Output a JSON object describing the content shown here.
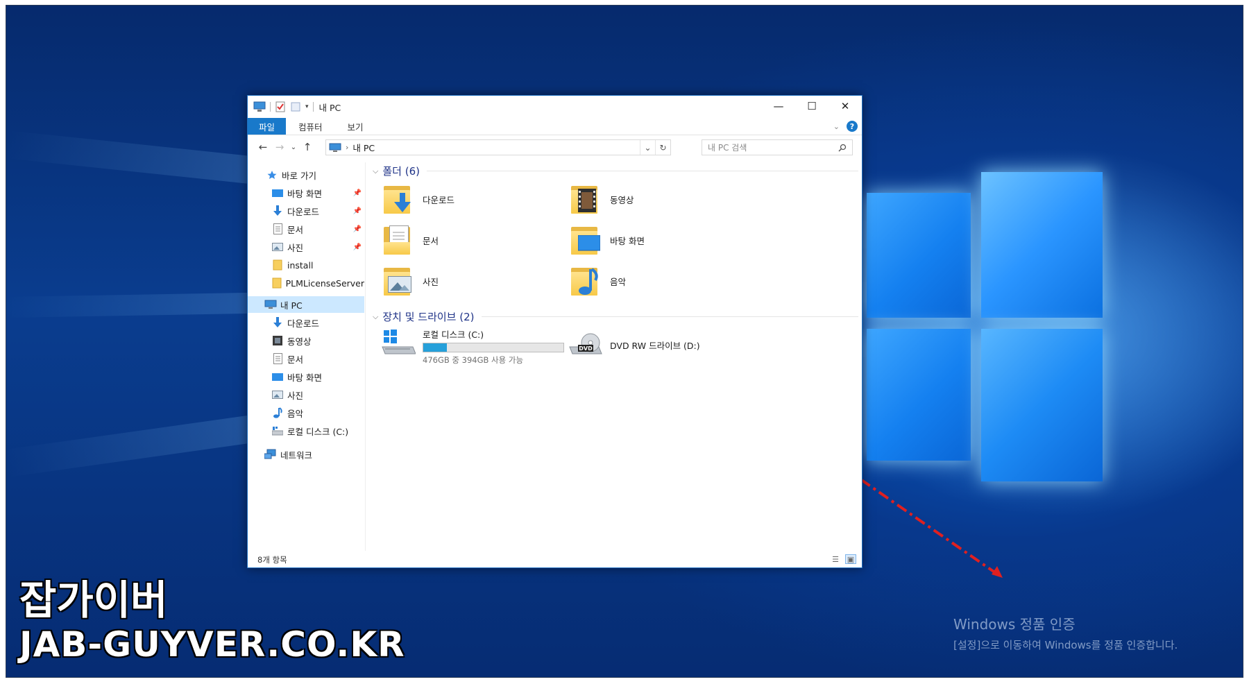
{
  "branding": {
    "site_name_kr": "잡가이버",
    "site_url": "JAB-GUYVER.CO.KR"
  },
  "activation_watermark": {
    "title": "Windows 정품 인증",
    "description": "[설정]으로 이동하여 Windows를 정품 인증합니다."
  },
  "window": {
    "title": "내 PC",
    "ribbon_tabs": [
      "파일",
      "컴퓨터",
      "보기"
    ],
    "address": "내 PC",
    "search_placeholder": "내 PC 검색",
    "status": "8개 항목"
  },
  "sidebar": {
    "quick_access": "바로 가기",
    "quick_items": [
      {
        "label": "바탕 화면",
        "icon": "desktop-icon",
        "pinned": true
      },
      {
        "label": "다운로드",
        "icon": "download-icon",
        "pinned": true
      },
      {
        "label": "문서",
        "icon": "document-icon",
        "pinned": true
      },
      {
        "label": "사진",
        "icon": "picture-icon",
        "pinned": true
      },
      {
        "label": "install",
        "icon": "folder-icon",
        "pinned": false
      },
      {
        "label": "PLMLicenseServer",
        "icon": "folder-icon",
        "pinned": false
      }
    ],
    "this_pc": "내 PC",
    "pc_items": [
      {
        "label": "다운로드",
        "icon": "download-icon"
      },
      {
        "label": "동영상",
        "icon": "video-icon"
      },
      {
        "label": "문서",
        "icon": "document-icon"
      },
      {
        "label": "바탕 화면",
        "icon": "desktop-icon"
      },
      {
        "label": "사진",
        "icon": "picture-icon"
      },
      {
        "label": "음악",
        "icon": "music-icon"
      },
      {
        "label": "로컬 디스크 (C:)",
        "icon": "drive-icon"
      }
    ],
    "network": "네트워크"
  },
  "content": {
    "folders_header": "폴더 (6)",
    "folders": [
      {
        "label": "다운로드",
        "icon": "download-folder-icon"
      },
      {
        "label": "동영상",
        "icon": "video-folder-icon"
      },
      {
        "label": "문서",
        "icon": "document-folder-icon"
      },
      {
        "label": "바탕 화면",
        "icon": "desktop-folder-icon"
      },
      {
        "label": "사진",
        "icon": "picture-folder-icon"
      },
      {
        "label": "음악",
        "icon": "music-folder-icon"
      }
    ],
    "devices_header": "장치 및 드라이브 (2)",
    "drives": [
      {
        "label": "로컬 디스크 (C:)",
        "detail": "476GB 중 394GB 사용 가능",
        "used_fraction": 0.17
      },
      {
        "label": "DVD RW 드라이브 (D:)",
        "dvd_badge": "DVD"
      }
    ]
  },
  "colors": {
    "accent": "#1979ca",
    "folder": "#f7c948",
    "progress": "#26a0da",
    "arrow": "#e02020"
  }
}
